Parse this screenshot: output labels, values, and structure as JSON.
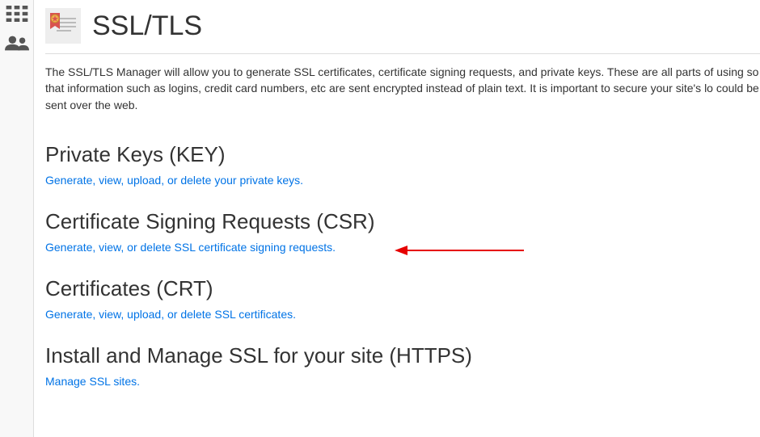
{
  "page": {
    "title": "SSL/TLS",
    "intro": "The SSL/TLS Manager will allow you to generate SSL certificates, certificate signing requests, and private keys. These are all parts of using so that information such as logins, credit card numbers, etc are sent encrypted instead of plain text. It is important to secure your site's lo could be sent over the web."
  },
  "sections": {
    "key": {
      "heading": "Private Keys (KEY)",
      "link": "Generate, view, upload, or delete your private keys."
    },
    "csr": {
      "heading": "Certificate Signing Requests (CSR)",
      "link": "Generate, view, or delete SSL certificate signing requests."
    },
    "crt": {
      "heading": "Certificates (CRT)",
      "link": "Generate, view, upload, or delete SSL certificates."
    },
    "install": {
      "heading": "Install and Manage SSL for your site (HTTPS)",
      "link": "Manage SSL sites."
    }
  }
}
